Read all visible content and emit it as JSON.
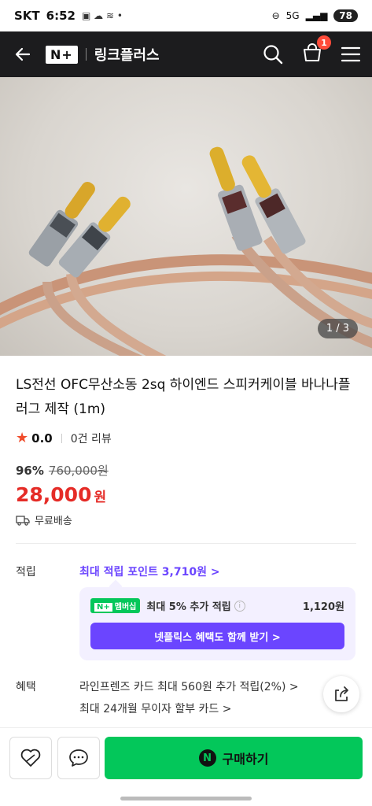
{
  "status_bar": {
    "carrier": "SKT",
    "time": "6:52",
    "network": "5G",
    "battery": "78"
  },
  "app_bar": {
    "logo_mark": "N+",
    "logo_text": "링크플러스",
    "cart_count": "1"
  },
  "gallery": {
    "counter": "1 / 3"
  },
  "product": {
    "title": "LS전선 OFC무산소동 2sq 하이엔드 스피커케이블 바나나플러그 제작 (1m)",
    "rating": "0.0",
    "review_count": "0건 리뷰",
    "discount": "96%",
    "original_price": "760,000원",
    "sale_price": "28,000",
    "currency": "원",
    "shipping": "무료배송"
  },
  "points": {
    "label": "적립",
    "max_points": "최대 적립 포인트 3,710원 >",
    "membership_badge": "멤버십",
    "membership_badge_mark": "N+",
    "membership_text": "최대 5% 추가 적립",
    "membership_info": "i",
    "membership_amount": "1,120원",
    "netflix_button": "넷플릭스 혜택도 함께 받기 >"
  },
  "benefits": {
    "label": "혜택",
    "line1": "라인프렌즈 카드 최대 560원 추가 적립(2%) >",
    "line2": "최대 24개월 무이자 할부 카드 >"
  },
  "bottom_bar": {
    "buy_label": "구매하기",
    "buy_mark": "N"
  }
}
